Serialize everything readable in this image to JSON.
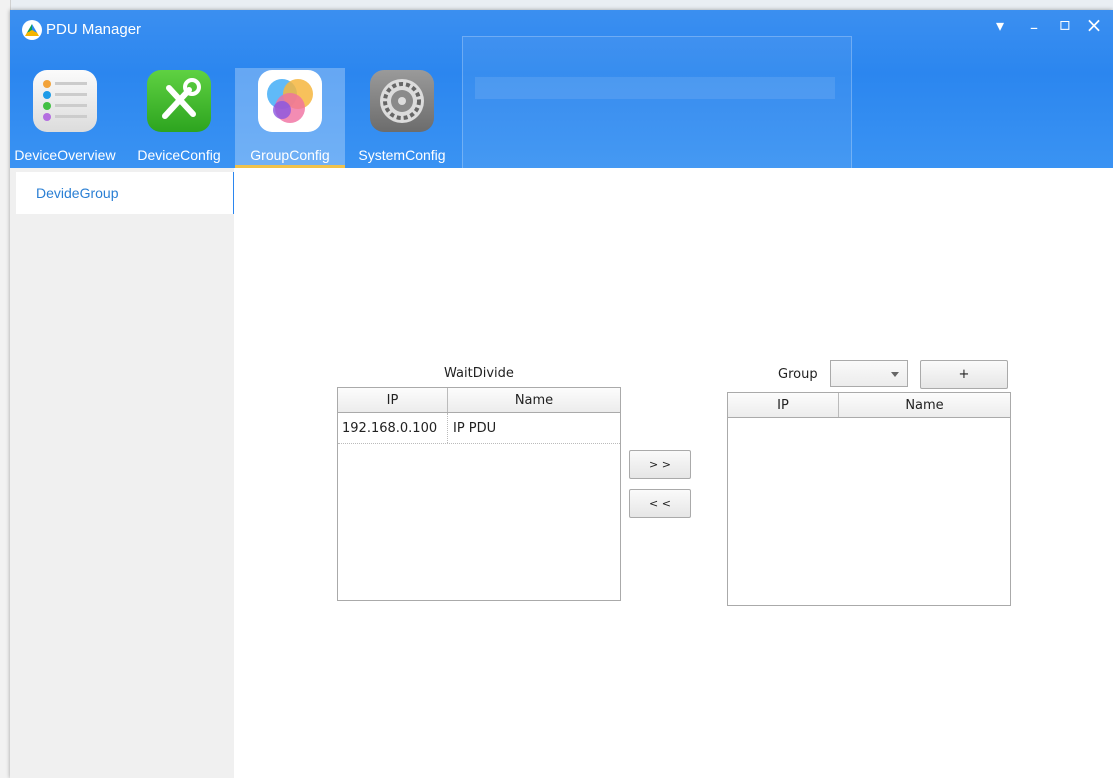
{
  "window": {
    "title": "PDU Manager"
  },
  "controls": {
    "menu": "▾",
    "minimize": "–",
    "maximize": "▫",
    "close": "×"
  },
  "tabs": [
    {
      "label": "DeviceOverview",
      "icon": "list-icon"
    },
    {
      "label": "DeviceConfig",
      "icon": "tools-icon"
    },
    {
      "label": "GroupConfig",
      "icon": "group-icon",
      "active": true
    },
    {
      "label": "SystemConfig",
      "icon": "gear-icon"
    }
  ],
  "sidebar": {
    "items": [
      {
        "label": "DevideGroup"
      }
    ]
  },
  "wait": {
    "title": "WaitDivide",
    "columns": [
      "IP",
      "Name"
    ],
    "rows": [
      {
        "ip": "192.168.0.100",
        "name": "IP PDU"
      }
    ]
  },
  "group": {
    "label": "Group",
    "selected": "",
    "add_label": "+",
    "columns": [
      "IP",
      "Name"
    ],
    "rows": []
  },
  "move": {
    "right": "> >",
    "left": "< <"
  },
  "colors": {
    "accent": "#2b86ef",
    "active_underline": "#f0c24c"
  }
}
